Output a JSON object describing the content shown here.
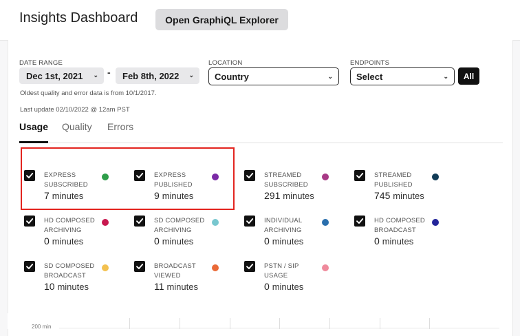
{
  "header": {
    "title": "Insights Dashboard",
    "graphiql_button": "Open GraphiQL Explorer"
  },
  "filters": {
    "date_range_label": "DATE RANGE",
    "start_date": "Dec 1st, 2021",
    "separator": "-",
    "end_date": "Feb 8th, 2022",
    "location_label": "LOCATION",
    "location_value": "Country",
    "endpoints_label": "ENDPOINTS",
    "endpoints_value": "Select",
    "all_button": "All",
    "oldest_note": "Oldest quality and error data is from 10/1/2017.",
    "last_update": "Last update 02/10/2022 @ 12am PST"
  },
  "tabs": [
    {
      "label": "Usage",
      "active": true
    },
    {
      "label": "Quality",
      "active": false
    },
    {
      "label": "Errors",
      "active": false
    }
  ],
  "metrics": [
    {
      "name": "EXPRESS\nSUBSCRIBED",
      "value": "7",
      "unit": "minutes",
      "color": "#2e9e4a",
      "checked": true
    },
    {
      "name": "EXPRESS\nPUBLISHED",
      "value": "9",
      "unit": "minutes",
      "color": "#7b2aa6",
      "checked": true
    },
    {
      "name": "STREAMED\nSUBSCRIBED",
      "value": "291",
      "unit": "minutes",
      "color": "#a83a86",
      "checked": true
    },
    {
      "name": "STREAMED\nPUBLISHED",
      "value": "745",
      "unit": "minutes",
      "color": "#113c57",
      "checked": true
    },
    {
      "name": "HD COMPOSED\nARCHIVING",
      "value": "0",
      "unit": "minutes",
      "color": "#c8184f",
      "checked": true
    },
    {
      "name": "SD COMPOSED\nARCHIVING",
      "value": "0",
      "unit": "minutes",
      "color": "#78c7cf",
      "checked": true
    },
    {
      "name": "INDIVIDUAL\nARCHIVING",
      "value": "0",
      "unit": "minutes",
      "color": "#2a6fad",
      "checked": true
    },
    {
      "name": "HD COMPOSED\nBROADCAST",
      "value": "0",
      "unit": "minutes",
      "color": "#23259a",
      "checked": true
    },
    {
      "name": "SD COMPOSED\nBROADCAST",
      "value": "10",
      "unit": "minutes",
      "color": "#f3c150",
      "checked": true
    },
    {
      "name": "BROADCAST\nVIEWED",
      "value": "11",
      "unit": "minutes",
      "color": "#ea6a38",
      "checked": true
    },
    {
      "name": "PSTN / SIP\nUSAGE",
      "value": "0",
      "unit": "minutes",
      "color": "#ef8a9c",
      "checked": true
    }
  ],
  "chart": {
    "y_tick": "200 min"
  }
}
